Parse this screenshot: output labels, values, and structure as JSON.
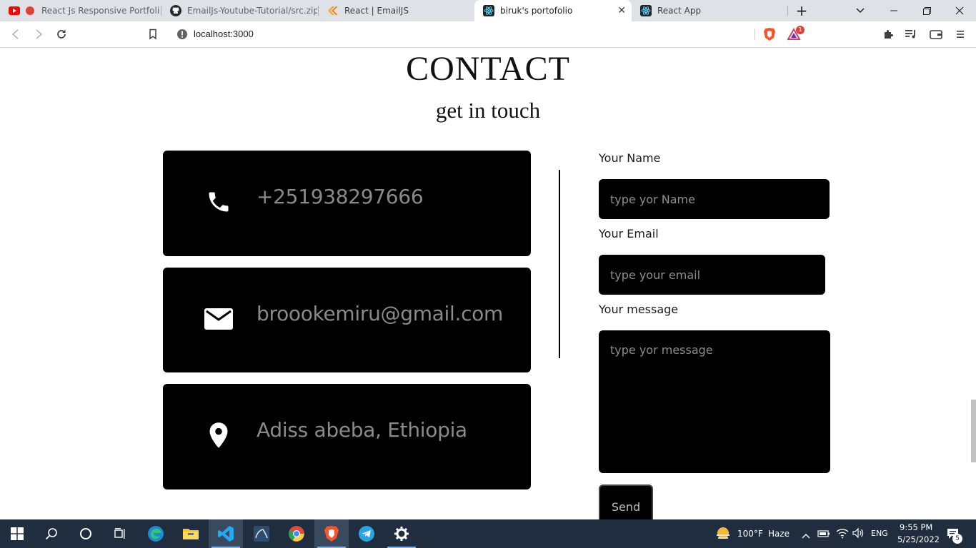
{
  "browser": {
    "tabs": [
      {
        "title": "React Js Responsive Portfolio w",
        "favicon": "youtube-icon",
        "active": false
      },
      {
        "title": "EmailJs-Youtube-Tutorial/src.zip at",
        "favicon": "github-icon",
        "active": false
      },
      {
        "title": "React | EmailJS",
        "favicon": "emailjs-icon",
        "active": false
      },
      {
        "title": "biruk's portofolio",
        "favicon": "react-icon",
        "active": true
      },
      {
        "title": "React App",
        "favicon": "react-icon",
        "active": false
      }
    ],
    "url": "localhost:3000",
    "brave_rewards_badge": "1"
  },
  "contact": {
    "title": "CONTACT",
    "subtitle": "get in touch",
    "cards": [
      {
        "icon": "phone-icon",
        "text": "+251938297666"
      },
      {
        "icon": "mail-icon",
        "text": "broookemiru@gmail.com"
      },
      {
        "icon": "location-pin-icon",
        "text": "Adiss abeba, Ethiopia"
      }
    ],
    "form": {
      "name_label": "Your Name",
      "name_placeholder": "type yor Name",
      "email_label": "Your Email",
      "email_placeholder": "type your email",
      "message_label": "Your message",
      "message_placeholder": "type yor message",
      "send_label": "Send"
    }
  },
  "taskbar": {
    "weather_temp": "100°F",
    "weather_desc": "Haze",
    "language": "ENG",
    "time": "9:55 PM",
    "date": "5/25/2022",
    "notification_count": "5"
  },
  "colors": {
    "card_bg": "#000000",
    "card_text": "#8a8a8a",
    "taskbar_bg": "#1f2d3f"
  }
}
